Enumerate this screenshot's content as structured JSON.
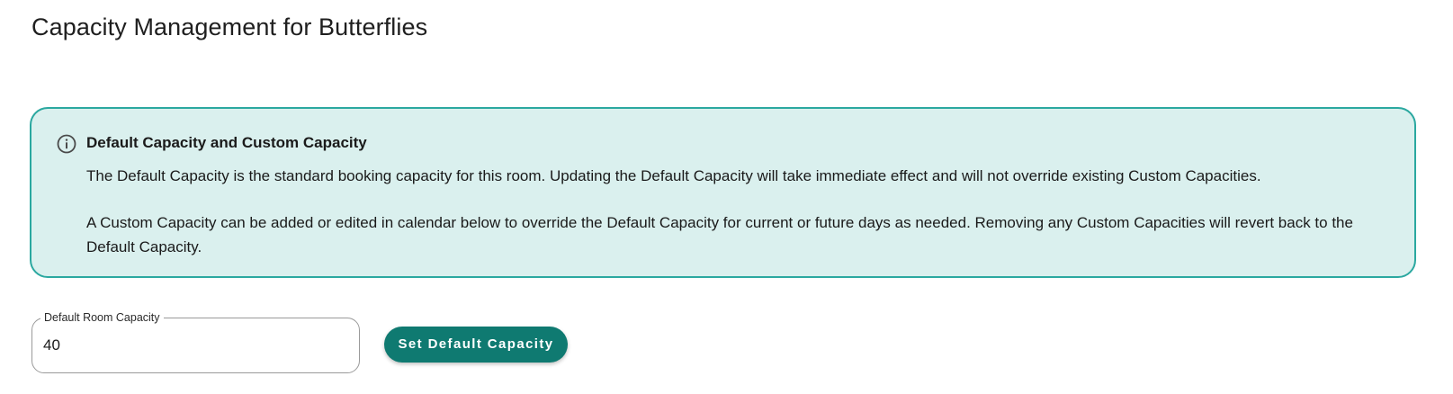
{
  "header": {
    "title": "Capacity Management for Butterflies"
  },
  "info_card": {
    "icon": "info-icon",
    "heading": "Default Capacity and Custom Capacity",
    "paragraph_1": "The Default Capacity is the standard booking capacity for this room. Updating the Default Capacity will take immediate effect and will not override existing Custom Capacities.",
    "paragraph_2": "A Custom Capacity can be added or edited in calendar below to override the Default Capacity for current or future days as needed. Removing any Custom Capacities will revert back to the Default Capacity.",
    "background_color": "#daf0ee",
    "border_color": "#2ba8a0"
  },
  "capacity_form": {
    "field_label": "Default Room Capacity",
    "field_value": "40",
    "button_label": "Set Default Capacity",
    "button_color": "#0f7a71"
  }
}
